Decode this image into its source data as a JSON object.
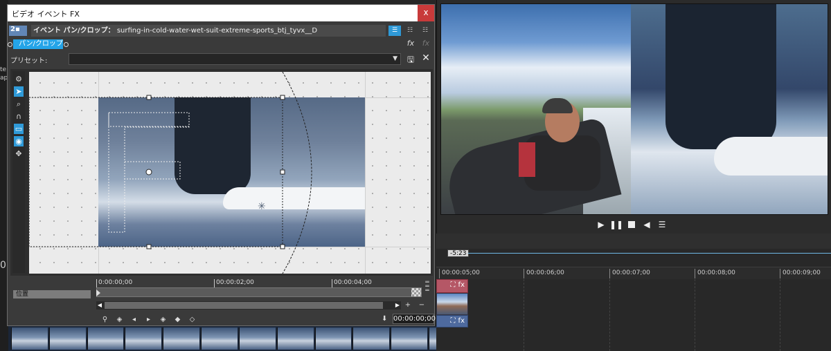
{
  "dialog": {
    "title": "ビデオ イベント FX",
    "close_label": "x",
    "chain": {
      "track_number": "2",
      "label": "イベント パン/クロップ：",
      "filename": "surfing-in-cold-water-wet-suit-extreme-sports_btj_tyvx__D"
    },
    "plugin_tab": "パン/クロップ",
    "fx_add_icon": "fx",
    "fx_icon2": "fx",
    "preset_label": "プリセット:",
    "preset_value": "",
    "keyframe": {
      "row_label": "位置",
      "ticks": [
        "0:00:00;00",
        "00:00:02;00",
        "00:00:04;00"
      ],
      "time_value": "00:00:00;00"
    }
  },
  "timeline": {
    "cursor_time": "-5:23",
    "ruler": [
      "00:00:05;00",
      "00:00:06;00",
      "00:00:07;00",
      "00:00:08;00",
      "00:00:09;00"
    ]
  },
  "left_fragments": [
    "te",
    "ap",
    "0"
  ],
  "icons": {
    "gear": "gear-icon",
    "arrow": "select-arrow-icon",
    "zoom": "zoom-icon",
    "magnet": "magnet-icon",
    "fit": "fit-icon",
    "center": "center-icon",
    "move": "move-icon"
  },
  "colors": {
    "accent": "#2f9ad8",
    "tab": "#24a4e8",
    "track_audio": "#b55766",
    "track_video": "#4e6a9e",
    "close": "#c83a3a"
  }
}
